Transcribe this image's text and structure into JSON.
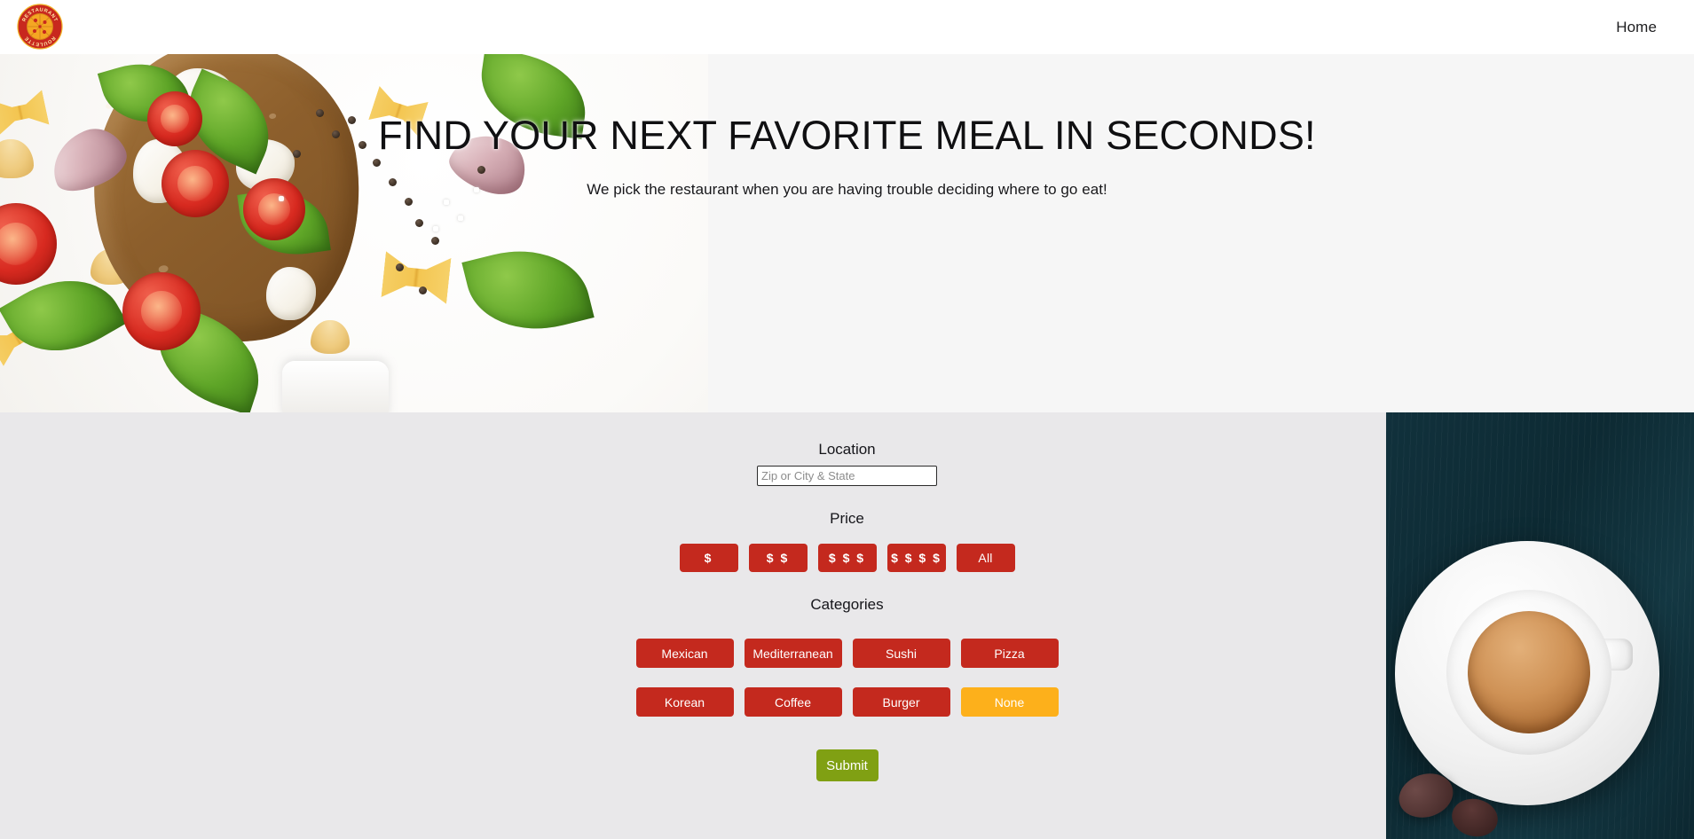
{
  "brand": {
    "logo_icon": "restaurant-roulette-logo-icon",
    "name_top": "RESTAURANT",
    "name_bottom": "ROULETTE"
  },
  "nav": {
    "links": [
      {
        "label": "Home"
      }
    ]
  },
  "hero": {
    "title": "FIND YOUR NEXT FAVORITE MEAL IN SECONDS!",
    "subtitle": "We pick the restaurant when you are having trouble deciding where to go eat!",
    "photo_alt": "bruschetta-with-tomato-spinach-mozzarella-garlic-and-pasta"
  },
  "form": {
    "location": {
      "label": "Location",
      "placeholder": "Zip or City & State",
      "value": ""
    },
    "price": {
      "label": "Price",
      "options": [
        {
          "label": "$",
          "selected": false
        },
        {
          "label": "$ $",
          "selected": false
        },
        {
          "label": "$ $ $",
          "selected": false
        },
        {
          "label": "$ $ $ $",
          "selected": false
        },
        {
          "label": "All",
          "selected": false
        }
      ]
    },
    "categories": {
      "label": "Categories",
      "row1": [
        {
          "label": "Mexican",
          "selected": false
        },
        {
          "label": "Mediterranean",
          "selected": false
        },
        {
          "label": "Sushi",
          "selected": false
        },
        {
          "label": "Pizza",
          "selected": false
        }
      ],
      "row2": [
        {
          "label": "Korean",
          "selected": false
        },
        {
          "label": "Coffee",
          "selected": false
        },
        {
          "label": "Burger",
          "selected": false
        },
        {
          "label": "None",
          "selected": true
        }
      ]
    },
    "submit_label": "Submit"
  },
  "side_photo": {
    "alt": "espresso-cup-on-dark-teal-wooden-table"
  },
  "colors": {
    "brand_red": "#c4291e",
    "selected_orange": "#fdb01b",
    "submit_green": "#80a013",
    "form_bg": "#e9e8ea",
    "hero_bg": "#f6f6f6",
    "nav_bg": "#ffffff"
  }
}
